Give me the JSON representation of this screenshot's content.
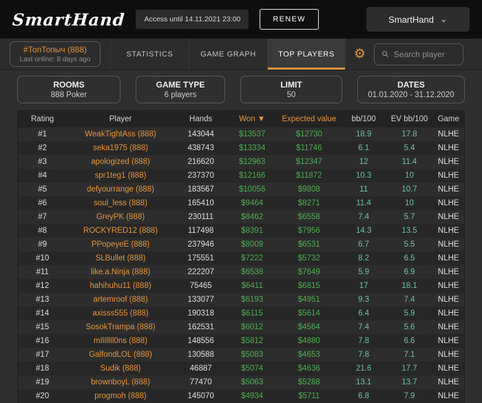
{
  "colors": {
    "orange": "#e8953c",
    "green": "#4caf50",
    "teal": "#6cc5a1",
    "topbar_bg": "#0e0e0e",
    "page_bg": "#2f2f2f"
  },
  "icons": {
    "gear": "⚙",
    "caret_down": "⌄",
    "search": "magnifier",
    "sort_desc": "▼"
  },
  "topbar": {
    "logo": "SmartHand",
    "access_label": "Access until 14.11.2021 23:00",
    "renew_label": "RENEW",
    "account_label": "SmartHand"
  },
  "tabbar": {
    "player_name": "#ТопТопыч (888)",
    "player_last_online": "Last online: 8 days ago",
    "tabs": [
      {
        "label": "STATISTICS",
        "active": false
      },
      {
        "label": "GAME GRAPH",
        "active": false
      },
      {
        "label": "TOP PLAYERS",
        "active": true
      }
    ],
    "search_placeholder": "Search player"
  },
  "filters": [
    {
      "title": "ROOMS",
      "value": "888 Poker"
    },
    {
      "title": "GAME TYPE",
      "value": "6 players"
    },
    {
      "title": "LIMIT",
      "value": "50"
    },
    {
      "title": "DATES",
      "value": "01.01.2020 - 31.12.2020"
    }
  ],
  "table": {
    "columns": [
      {
        "label": "Rating",
        "accent": false
      },
      {
        "label": "Player",
        "accent": false
      },
      {
        "label": "Hands",
        "accent": false
      },
      {
        "label": "Won ▼",
        "accent": true
      },
      {
        "label": "Expected value",
        "accent": true
      },
      {
        "label": "bb/100",
        "accent": false
      },
      {
        "label": "EV bb/100",
        "accent": false
      },
      {
        "label": "Game",
        "accent": false
      }
    ],
    "rows": [
      [
        "#1",
        "WeakTightAss (888)",
        "143044",
        "$13537",
        "$12730",
        "18.9",
        "17.8",
        "NLHE"
      ],
      [
        "#2",
        "seka1975 (888)",
        "438743",
        "$13334",
        "$11746",
        "6.1",
        "5.4",
        "NLHE"
      ],
      [
        "#3",
        "apologized (888)",
        "216620",
        "$12963",
        "$12347",
        "12",
        "11.4",
        "NLHE"
      ],
      [
        "#4",
        "spr1teg1 (888)",
        "237370",
        "$12166",
        "$11872",
        "10.3",
        "10",
        "NLHE"
      ],
      [
        "#5",
        "defyourrange (888)",
        "183567",
        "$10056",
        "$9808",
        "11",
        "10.7",
        "NLHE"
      ],
      [
        "#6",
        "soul_less (888)",
        "165410",
        "$9464",
        "$8271",
        "11.4",
        "10",
        "NLHE"
      ],
      [
        "#7",
        "GreyPK (888)",
        "230111",
        "$8462",
        "$6558",
        "7.4",
        "5.7",
        "NLHE"
      ],
      [
        "#8",
        "ROCKYRED12 (888)",
        "117498",
        "$8391",
        "$7956",
        "14.3",
        "13.5",
        "NLHE"
      ],
      [
        "#9",
        "PPopeyeE (888)",
        "237946",
        "$8009",
        "$6531",
        "6.7",
        "5.5",
        "NLHE"
      ],
      [
        "#10",
        "SLBullet (888)",
        "175551",
        "$7222",
        "$5732",
        "8.2",
        "6.5",
        "NLHE"
      ],
      [
        "#11",
        "like.a.Ninja (888)",
        "222207",
        "$6538",
        "$7649",
        "5.9",
        "6.9",
        "NLHE"
      ],
      [
        "#12",
        "hahihuhu11 (888)",
        "75465",
        "$6411",
        "$6815",
        "17",
        "18.1",
        "NLHE"
      ],
      [
        "#13",
        "artemroof (888)",
        "133077",
        "$6193",
        "$4951",
        "9.3",
        "7.4",
        "NLHE"
      ],
      [
        "#14",
        "axisss555 (888)",
        "190318",
        "$6115",
        "$5614",
        "6.4",
        "5.9",
        "NLHE"
      ],
      [
        "#15",
        "SosokTrampa (888)",
        "162531",
        "$6012",
        "$4564",
        "7.4",
        "5.6",
        "NLHE"
      ],
      [
        "#16",
        "mIlIllIl0ns (888)",
        "148556",
        "$5812",
        "$4880",
        "7.8",
        "6.6",
        "NLHE"
      ],
      [
        "#17",
        "GalfondLOL (888)",
        "130588",
        "$5083",
        "$4653",
        "7.8",
        "7.1",
        "NLHE"
      ],
      [
        "#18",
        "Sudik (888)",
        "46887",
        "$5074",
        "$4636",
        "21.6",
        "17.7",
        "NLHE"
      ],
      [
        "#19",
        "brownboyL (888)",
        "77470",
        "$5063",
        "$5288",
        "13.1",
        "13.7",
        "NLHE"
      ],
      [
        "#20",
        "progmoh (888)",
        "145070",
        "$4934",
        "$5711",
        "6.8",
        "7.9",
        "NLHE"
      ]
    ]
  }
}
